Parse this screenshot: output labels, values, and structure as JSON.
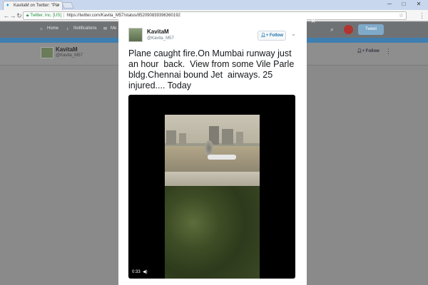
{
  "browser": {
    "tab_title": "KavitaM on Twitter: \"Pla",
    "tab_close": "×",
    "url_secure_label": "Twitter, Inc. [US]",
    "url": "https://twitter.com/Kavita_M57/status/852090839396360192",
    "window_min": "─",
    "window_max": "□",
    "window_close": "✕"
  },
  "twitter_nav": {
    "home": "Home",
    "notifications": "Notifications",
    "messages": "Me",
    "tweet_button": "Tweet"
  },
  "background_profile": {
    "name": "KavitaM",
    "handle": "@Kavita_M57",
    "follow": "Follow"
  },
  "tweet": {
    "name": "KavitaM",
    "handle": "@Kavita_M57",
    "follow_label": "Follow",
    "text": "Plane caught fire.On Mumbai runway just an hour  back.  View from some Vile Parle bldg.Chennai bound Jet  airways. 25 injured.... Today",
    "video_time": "0:33"
  },
  "colors": {
    "twitter_blue": "#1da1f2",
    "secure_green": "#1a8a3a"
  },
  "icons": {
    "close": "×",
    "more": "⋮",
    "chevron": "⌄",
    "star": "☆",
    "search": "⌕",
    "volume": "◀)"
  }
}
